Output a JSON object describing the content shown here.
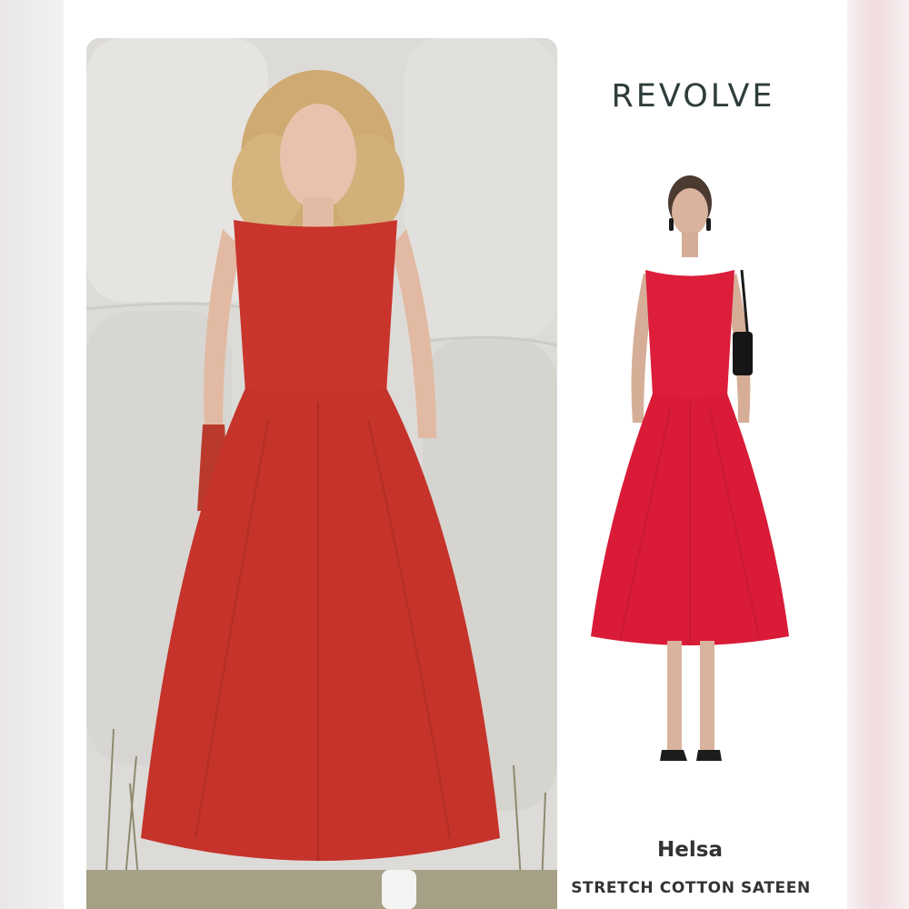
{
  "colors": {
    "dress_editorial": "#c9352c",
    "dress_product": "#dc1e3a",
    "brand_text": "#2f3c3c",
    "caption_text": "#333333"
  },
  "brand": {
    "logo": "REVOLVE"
  },
  "product": {
    "name": "Helsa",
    "fabric": "STRETCH COTTON SATEEN"
  }
}
